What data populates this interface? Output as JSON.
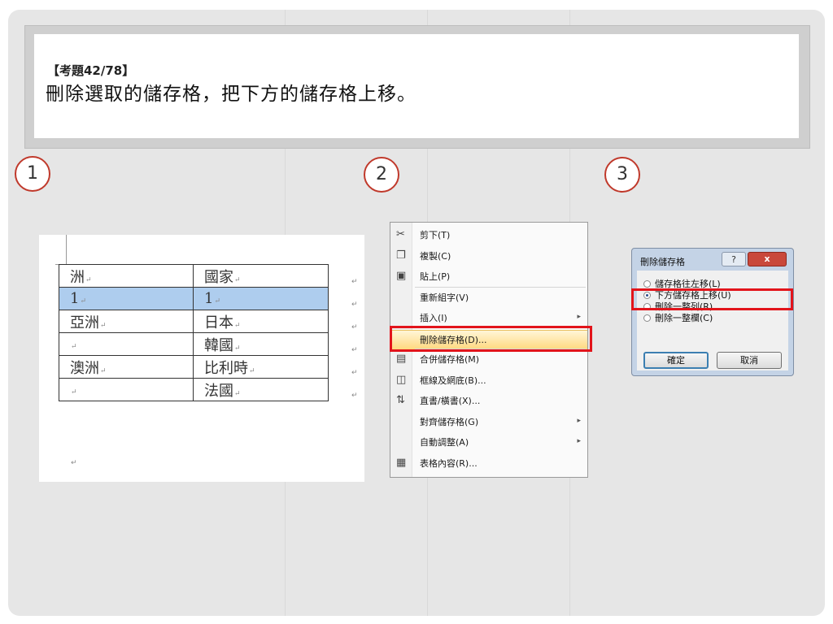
{
  "title": {
    "question_number": "【考題42/78】",
    "question_text": "刪除選取的儲存格，把下方的儲存格上移。"
  },
  "steps": [
    "1",
    "2",
    "3"
  ],
  "word_table": {
    "end_mark": "↵",
    "rows": [
      {
        "c1": "洲",
        "c2": "國家",
        "selected": false
      },
      {
        "c1": "1",
        "c2": "1",
        "selected": true
      },
      {
        "c1": "亞洲",
        "c2": "日本",
        "selected": false
      },
      {
        "c1": "",
        "c2": "韓國",
        "selected": false
      },
      {
        "c1": "澳洲",
        "c2": "比利時",
        "selected": false
      },
      {
        "c1": "",
        "c2": "法國",
        "selected": false
      }
    ]
  },
  "context_menu": {
    "items": [
      {
        "label": "剪下(T)",
        "icon": "scissors-icon"
      },
      {
        "label": "複製(C)",
        "icon": "copy-icon"
      },
      {
        "label": "貼上(P)",
        "icon": "paste-icon"
      },
      {
        "label": "重新組字(V)",
        "icon": ""
      },
      {
        "label": "插入(I)",
        "icon": "",
        "submenu": true
      },
      {
        "label": "刪除儲存格(D)...",
        "icon": "",
        "highlighted": true
      },
      {
        "label": "合併儲存格(M)",
        "icon": "merge-cells-icon"
      },
      {
        "label": "框線及網底(B)...",
        "icon": "borders-icon"
      },
      {
        "label": "直書/橫書(X)...",
        "icon": "text-direction-icon"
      },
      {
        "label": "對齊儲存格(G)",
        "icon": "",
        "submenu": true
      },
      {
        "label": "自動調整(A)",
        "icon": "",
        "submenu": true
      },
      {
        "label": "表格內容(R)...",
        "icon": "table-properties-icon"
      }
    ]
  },
  "dialog": {
    "title": "刪除儲存格",
    "help_label": "?",
    "close_label": "x",
    "options": [
      {
        "label": "儲存格往左移(L)",
        "selected": false
      },
      {
        "label": "下方儲存格上移(U)",
        "selected": true
      },
      {
        "label": "刪除一整列(R)",
        "selected": false
      },
      {
        "label": "刪除一整欄(C)",
        "selected": false
      }
    ],
    "ok_label": "確定",
    "cancel_label": "取消"
  },
  "colors": {
    "highlight_red": "#e2141b",
    "selection_blue": "#aecdee",
    "step_circle": "#c0392b"
  }
}
